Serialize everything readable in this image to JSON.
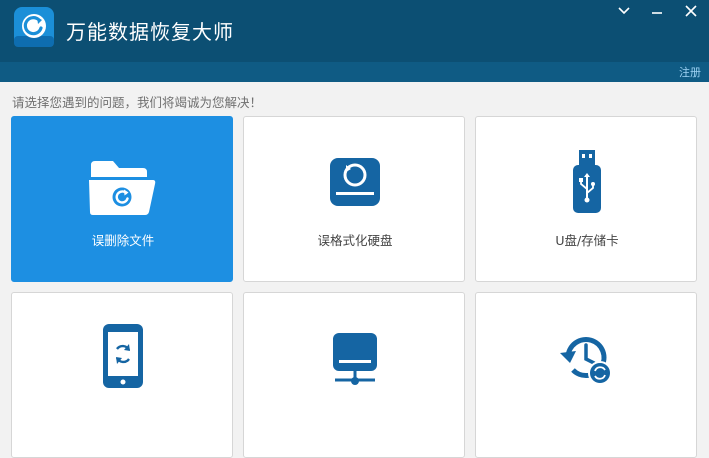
{
  "window": {
    "title": "万能数据恢复大师",
    "controls": [
      "chevron-down-icon",
      "minimize-icon",
      "close-icon"
    ]
  },
  "subbar": {
    "register_label": "注册"
  },
  "instruction": "请选择您遇到的问题，我们将竭诚为您解决！",
  "tiles": [
    {
      "label": "误删除文件",
      "icon": "folder-refresh-icon",
      "selected": true
    },
    {
      "label": "误格式化硬盘",
      "icon": "hard-drive-refresh-icon",
      "selected": false
    },
    {
      "label": "U盘/存储卡",
      "icon": "usb-drive-icon",
      "selected": false
    },
    {
      "label": "",
      "icon": "phone-refresh-icon",
      "selected": false
    },
    {
      "label": "",
      "icon": "network-drive-icon",
      "selected": false
    },
    {
      "label": "",
      "icon": "history-recovery-icon",
      "selected": false
    }
  ],
  "colors": {
    "titlebar": "#0c4f73",
    "subbar": "#0f5b84",
    "accent": "#1d8fe2",
    "icon_blue": "#1565a3",
    "link": "#9fd3f4"
  }
}
